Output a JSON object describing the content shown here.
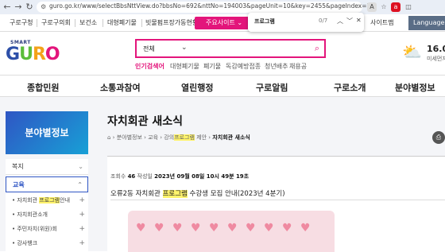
{
  "browser": {
    "url": "guro.go.kr/www/selectBbsNttView.do?bbsNo=692&nttNo=194003&pageUnit=10&key=2455&pageIndex=1",
    "back": "←",
    "forward": "→",
    "reload": "↻"
  },
  "findbar": {
    "query": "프로그램",
    "count": "0/7",
    "up": "︿",
    "down": "﹀",
    "close": "✕"
  },
  "topbar": {
    "links": [
      "구로구청",
      "구로구의회",
      "보건소",
      "대형폐기물",
      "빗물펌프장가동현황"
    ],
    "main_site": "주요사이트",
    "site_map": "사이트맵",
    "language": "Language"
  },
  "logo": {
    "small": "SMART",
    "big": "GURO"
  },
  "search": {
    "select": "전체",
    "keywords_label": "인기검색어",
    "keywords": [
      "대형폐기물",
      "폐기물",
      "독감예방접종",
      "청년배추",
      "채용공"
    ]
  },
  "weather": {
    "temp": "16.0",
    "sub": "미세먼지"
  },
  "gnb": [
    "종합민원",
    "소통과참여",
    "열린행정",
    "구로알림",
    "구로소개",
    "분야별정보"
  ],
  "sidebar": {
    "title": "분야별정보",
    "items": [
      "복지",
      "교육"
    ],
    "subitems": [
      {
        "pre": "자치회관 ",
        "hl": "프로그램",
        "post": "안내"
      },
      {
        "pre": "자치회관소개",
        "hl": "",
        "post": ""
      },
      {
        "pre": "주민자치(위원)회",
        "hl": "",
        "post": ""
      },
      {
        "pre": "강사뱅크",
        "hl": "",
        "post": ""
      }
    ]
  },
  "page": {
    "title": "자치회관 새소식",
    "breadcrumb": [
      "분야별정보",
      "교육",
      "강의",
      "프로그램",
      "제안",
      "자치회관 새소식"
    ]
  },
  "post": {
    "views_label": "조회수",
    "views": "46",
    "date_label": "작성일",
    "date": "2023년 09월 08일 10시 49분 19초",
    "title_pre": "오류2동 자치회관 ",
    "title_hl": "프로그램",
    "title_post": " 수강생 모집 안내(2023년 4분기)"
  },
  "colors": {
    "accent": "#e3157b",
    "brand_blue": "#2f56c4",
    "highlight": "#fff36b"
  }
}
